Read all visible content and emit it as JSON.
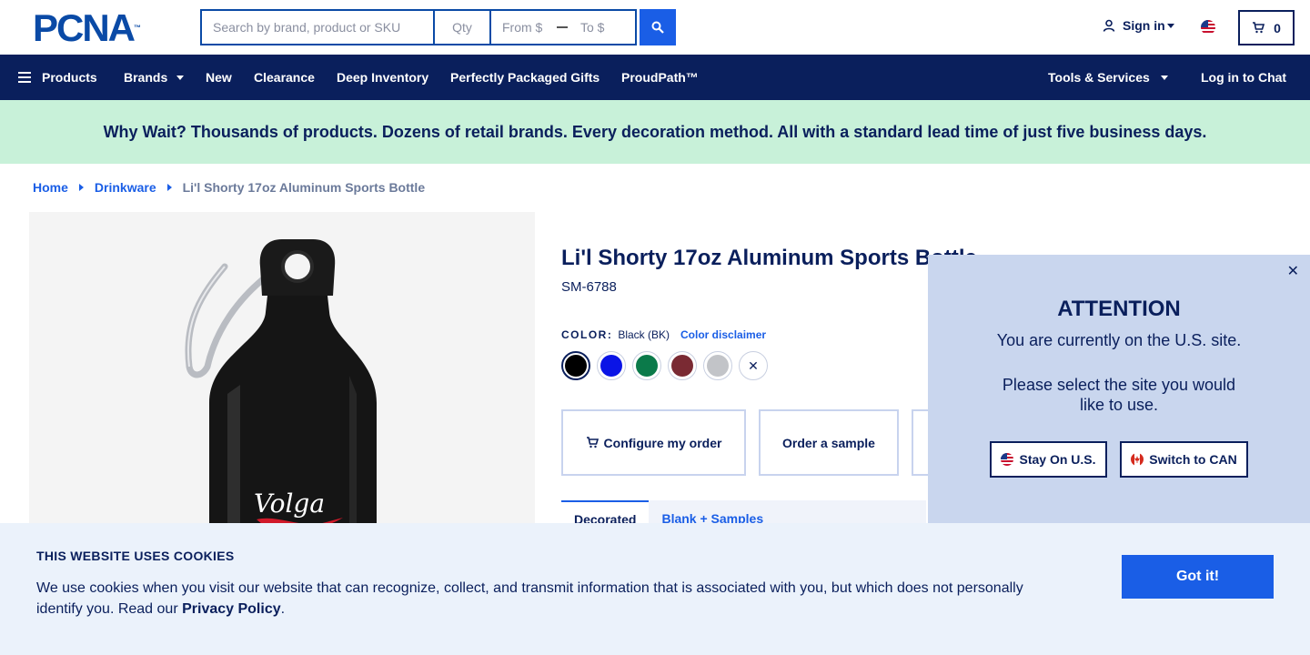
{
  "header": {
    "logo_text": "PCNA",
    "logo_tm": "™",
    "search_placeholder": "Search by brand, product or SKU",
    "qty_placeholder": "Qty",
    "from_placeholder": "From $",
    "to_placeholder": "To $",
    "sign_in": "Sign in",
    "cart_count": "0"
  },
  "nav": {
    "products": "Products",
    "brands": "Brands",
    "new": "New",
    "clearance": "Clearance",
    "deep_inventory": "Deep Inventory",
    "gifts": "Perfectly Packaged Gifts",
    "proudpath": "ProudPath™",
    "tools": "Tools & Services",
    "chat": "Log in to Chat"
  },
  "banner": {
    "text": "Why Wait? Thousands of products. Dozens of retail brands. Every decoration method. All with a standard lead time of just five business days."
  },
  "breadcrumb": {
    "home": "Home",
    "category": "Drinkware",
    "current": "Li'l Shorty 17oz Aluminum Sports Bottle"
  },
  "product": {
    "title": "Li'l Shorty 17oz Aluminum Sports Bottle",
    "sku": "SM-6788",
    "color_label": "COLOR:",
    "color_value": "Black (BK)",
    "color_disclaimer": "Color disclaimer",
    "swatches": [
      {
        "name": "Black",
        "hex": "#000000"
      },
      {
        "name": "Blue",
        "hex": "#0a14e6"
      },
      {
        "name": "Green",
        "hex": "#0b7a4a"
      },
      {
        "name": "Burgundy",
        "hex": "#7a2a33"
      },
      {
        "name": "Silver",
        "hex": "#c2c4c8"
      }
    ],
    "imprint_text": "Volga",
    "configure": "Configure my order",
    "sample": "Order a sample",
    "tab_active": "Decorated",
    "tab_inactive": "Blank + Samples"
  },
  "attention": {
    "title": "ATTENTION",
    "line1": "You are currently on the U.S. site.",
    "line2": "Please select the site you would like to use.",
    "stay": "Stay On U.S.",
    "switch": "Switch to CAN"
  },
  "cookie": {
    "title": "THIS WEBSITE USES COOKIES",
    "text_before": "We use cookies when you visit our website that can recognize, collect, and transmit information that is associated with you, but which does not personally identify you. Read our ",
    "link": "Privacy Policy",
    "text_after": ".",
    "button": "Got it!"
  },
  "colors": {
    "navy": "#0a1f5c",
    "accent_blue": "#1a5ee6",
    "banner_green": "#c8f1d9",
    "popup_bg": "#c9d6ee",
    "cookie_bg": "#ebf2fb"
  }
}
